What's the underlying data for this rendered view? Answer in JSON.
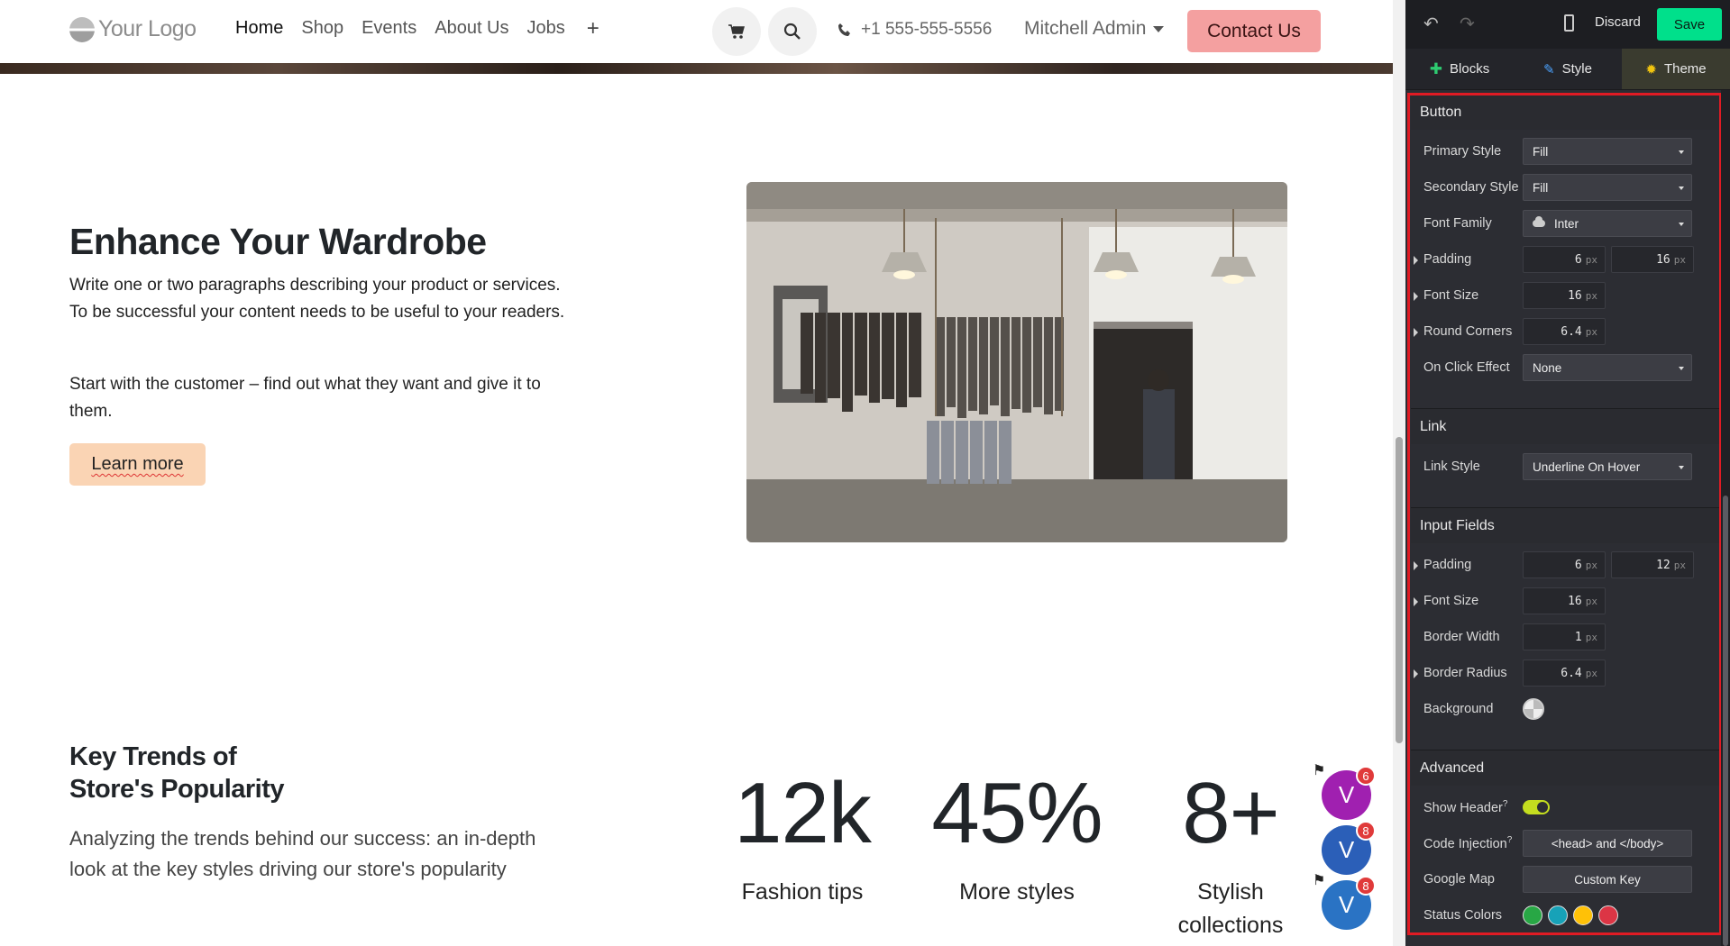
{
  "site": {
    "logo_text": "Your Logo",
    "nav": [
      "Home",
      "Shop",
      "Events",
      "About Us",
      "Jobs"
    ],
    "nav_add": "+",
    "phone": "+1 555-555-5556",
    "user": "Mitchell Admin",
    "contact_label": "Contact Us",
    "hero": {
      "title_plain": "Enhance Your ",
      "title_bold": "Wardrobe",
      "para1": "Write one or two paragraphs describing your product or services. To be successful your content needs to be useful to your readers.",
      "para2": "Start with the customer – find out what they want and give it to them.",
      "button": "Learn more"
    },
    "trends": {
      "title_line1": "Key Trends of",
      "title_line2": "Store's Popularity",
      "para": "Analyzing the trends behind our success: an in-depth look at the key styles driving our store's popularity"
    },
    "stats": [
      {
        "value": "12k",
        "label": "Fashion tips"
      },
      {
        "value": "45%",
        "label": "More styles"
      },
      {
        "value": "8+",
        "label": "Stylish collections"
      }
    ],
    "avatars": [
      {
        "letter": "V",
        "badge": "6",
        "color": "#a020b0"
      },
      {
        "letter": "V",
        "badge": "8",
        "color": "#2b5fb8"
      },
      {
        "letter": "V",
        "badge": "8",
        "color": "#2a73c4"
      }
    ]
  },
  "editor": {
    "discard": "Discard",
    "save": "Save",
    "tabs": [
      "Blocks",
      "Style",
      "Theme"
    ],
    "active_tab": "Theme",
    "button_section": {
      "title": "Button",
      "primary_style_label": "Primary Style",
      "primary_style_value": "Fill",
      "secondary_style_label": "Secondary Style",
      "secondary_style_value": "Fill",
      "font_family_label": "Font Family",
      "font_family_value": "Inter",
      "padding_label": "Padding",
      "padding_y": "6",
      "padding_x": "16",
      "font_size_label": "Font Size",
      "font_size": "16",
      "round_corners_label": "Round Corners",
      "round_corners": "6.4",
      "on_click_label": "On Click Effect",
      "on_click_value": "None"
    },
    "link_section": {
      "title": "Link",
      "link_style_label": "Link Style",
      "link_style_value": "Underline On Hover"
    },
    "input_section": {
      "title": "Input Fields",
      "padding_label": "Padding",
      "padding_y": "6",
      "padding_x": "12",
      "font_size_label": "Font Size",
      "font_size": "16",
      "border_width_label": "Border Width",
      "border_width": "1",
      "border_radius_label": "Border Radius",
      "border_radius": "6.4",
      "background_label": "Background"
    },
    "advanced_section": {
      "title": "Advanced",
      "show_header_label": "Show Header",
      "show_header_on": true,
      "code_injection_label": "Code Injection",
      "code_injection_value": "<head> and </body>",
      "google_map_label": "Google Map",
      "google_map_value": "Custom Key",
      "status_colors_label": "Status Colors",
      "status_colors": [
        "#28a745",
        "#17a2b8",
        "#ffc107",
        "#dc3545"
      ]
    },
    "unit": "px",
    "help_mark": "?"
  }
}
